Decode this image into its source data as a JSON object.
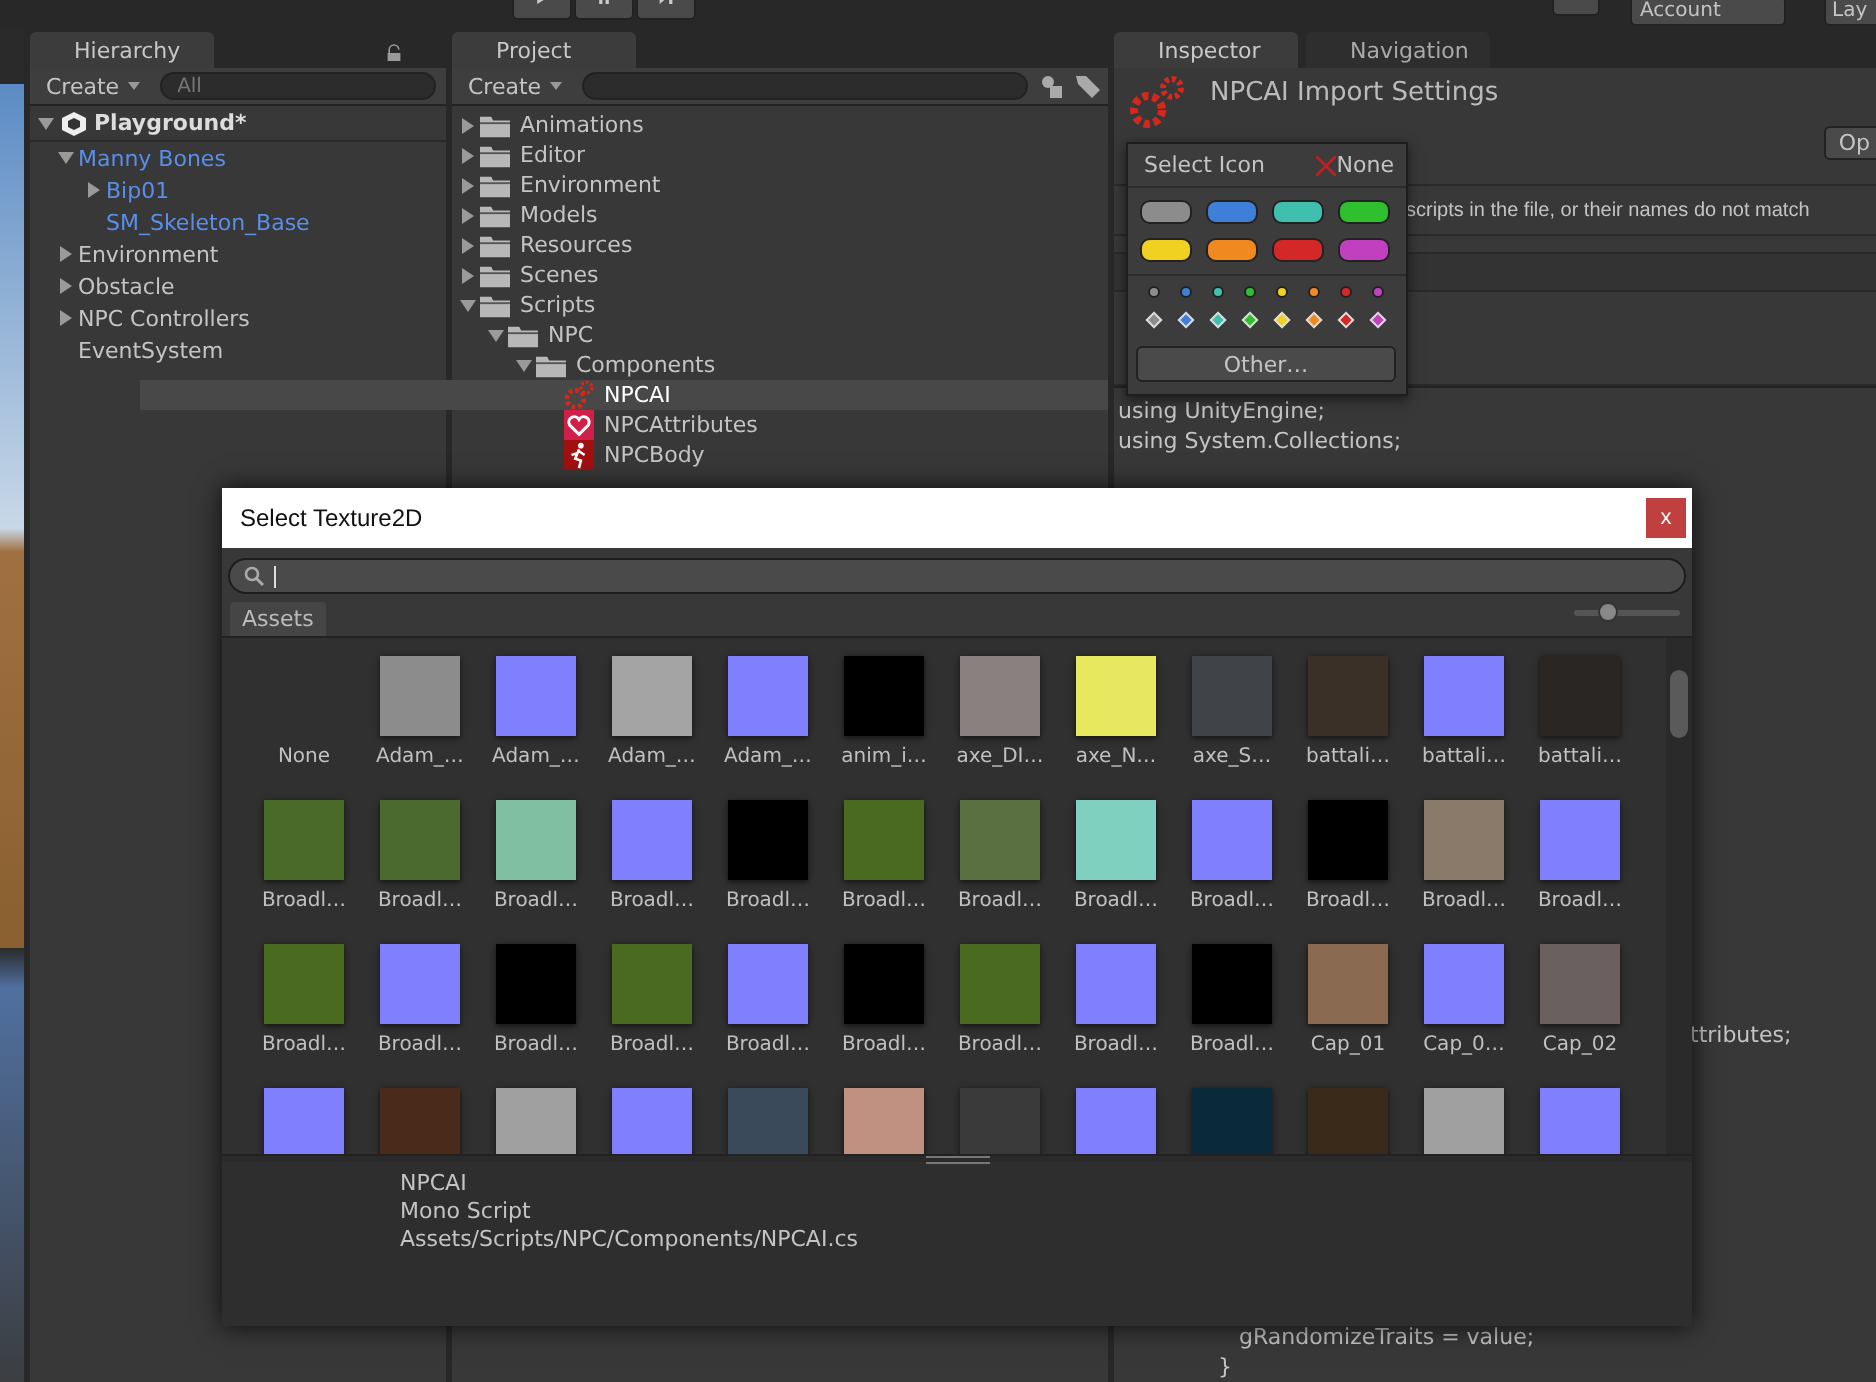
{
  "toolbar": {
    "account": "Account",
    "layout": "Lay"
  },
  "hierarchy": {
    "tab": "Hierarchy",
    "create": "Create",
    "search_placeholder": "All",
    "scene": "Playground*",
    "items": [
      {
        "name": "Manny Bones",
        "prefab": true,
        "expandable": true,
        "expanded": true,
        "children": [
          {
            "name": "Bip01",
            "prefab": true,
            "expandable": true,
            "expanded": false
          },
          {
            "name": "SM_Skeleton_Base",
            "prefab": true,
            "expandable": false
          }
        ]
      },
      {
        "name": "Environment",
        "prefab": false,
        "expandable": true,
        "expanded": false
      },
      {
        "name": "Obstacle",
        "prefab": false,
        "expandable": true,
        "expanded": false
      },
      {
        "name": "NPC Controllers",
        "prefab": false,
        "expandable": true,
        "expanded": false
      },
      {
        "name": "EventSystem",
        "prefab": false,
        "expandable": false
      }
    ]
  },
  "project": {
    "tab": "Project",
    "create": "Create",
    "items": [
      {
        "name": "Animations",
        "kind": "folder",
        "expandable": true,
        "expanded": false,
        "selected": false
      },
      {
        "name": "Editor",
        "kind": "folder",
        "expandable": true,
        "expanded": false,
        "selected": false
      },
      {
        "name": "Environment",
        "kind": "folder",
        "expandable": true,
        "expanded": false,
        "selected": false
      },
      {
        "name": "Models",
        "kind": "folder",
        "expandable": true,
        "expanded": false,
        "selected": false
      },
      {
        "name": "Resources",
        "kind": "folder",
        "expandable": true,
        "expanded": false,
        "selected": false
      },
      {
        "name": "Scenes",
        "kind": "folder",
        "expandable": true,
        "expanded": false,
        "selected": false
      },
      {
        "name": "Scripts",
        "kind": "folder",
        "expandable": true,
        "expanded": true,
        "selected": false,
        "children": [
          {
            "name": "NPC",
            "kind": "folder",
            "expandable": true,
            "expanded": true,
            "selected": false,
            "children": [
              {
                "name": "Components",
                "kind": "folder",
                "expandable": true,
                "expanded": true,
                "selected": false,
                "children": [
                  {
                    "name": "NPCAI",
                    "kind": "script",
                    "expandable": false,
                    "selected": true
                  },
                  {
                    "name": "NPCAttributes",
                    "kind": "heart",
                    "expandable": false,
                    "selected": false
                  },
                  {
                    "name": "NPCBody",
                    "kind": "runner",
                    "expandable": false,
                    "selected": false
                  }
                ]
              }
            ]
          }
        ]
      }
    ]
  },
  "inspector": {
    "tabs": [
      {
        "label": "Inspector",
        "selected": true
      },
      {
        "label": "Navigation",
        "selected": false
      }
    ],
    "title": "NPCAI Import Settings",
    "open_button": "Op",
    "message": "scripts in the file, or their names do not match",
    "code_top": [
      "using UnityEngine;",
      "using System.Collections;"
    ],
    "code_fragment": "ttributes;",
    "code_bottom": [
      "   gRandomizeTraits = value;",
      "}"
    ]
  },
  "icon_picker": {
    "title": "Select Icon",
    "none": "None",
    "other": "Other…",
    "colors": [
      {
        "color": "#8c8c8c"
      },
      {
        "color": "#3f7fd8"
      },
      {
        "color": "#3fbfae"
      },
      {
        "color": "#2fbf2f"
      },
      {
        "color": "#f0d020"
      },
      {
        "color": "#f08a20"
      },
      {
        "color": "#d42828"
      },
      {
        "color": "#c040c0"
      }
    ]
  },
  "dialog": {
    "title": "Select Texture2D",
    "close": "x",
    "tab": "Assets",
    "zoom_slider": {
      "level": 0.33
    },
    "items": [
      {
        "label": "None"
      },
      {
        "label": "Adam_…",
        "color": "#8c8c8c"
      },
      {
        "label": "Adam_…",
        "color": "#8080ff"
      },
      {
        "label": "Adam_…",
        "color": "#a4a4a4"
      },
      {
        "label": "Adam_…",
        "color": "#8080ff"
      },
      {
        "label": "anim_i…",
        "color": "#000000"
      },
      {
        "label": "axe_DI…",
        "color": "#8a8080"
      },
      {
        "label": "axe_N…",
        "color": "#e8e860"
      },
      {
        "label": "axe_S…",
        "color": "#404448"
      },
      {
        "label": "battali…",
        "color": "#3a3028"
      },
      {
        "label": "battali…",
        "color": "#8080ff"
      },
      {
        "label": "battali…",
        "color": "#2a2624"
      },
      {
        "label": "Broadl…",
        "color": "#4a6a2a"
      },
      {
        "label": "Broadl…",
        "color": "#4a6a30"
      },
      {
        "label": "Broadl…",
        "color": "#80c0a0"
      },
      {
        "label": "Broadl…",
        "color": "#8080ff"
      },
      {
        "label": "Broadl…",
        "color": "#000000"
      },
      {
        "label": "Broadl…",
        "color": "#4a6a20"
      },
      {
        "label": "Broadl…",
        "color": "#5a7040"
      },
      {
        "label": "Broadl…",
        "color": "#80d0c0"
      },
      {
        "label": "Broadl…",
        "color": "#8080ff"
      },
      {
        "label": "Broadl…",
        "color": "#000000"
      },
      {
        "label": "Broadl…",
        "color": "#8a7a6a"
      },
      {
        "label": "Broadl…",
        "color": "#8080ff"
      },
      {
        "label": "Broadl…",
        "color": "#4a6a20"
      },
      {
        "label": "Broadl…",
        "color": "#8080ff"
      },
      {
        "label": "Broadl…",
        "color": "#000000"
      },
      {
        "label": "Broadl…",
        "color": "#4a6a20"
      },
      {
        "label": "Broadl…",
        "color": "#8080ff"
      },
      {
        "label": "Broadl…",
        "color": "#000000"
      },
      {
        "label": "Broadl…",
        "color": "#4a6a20"
      },
      {
        "label": "Broadl…",
        "color": "#8080ff"
      },
      {
        "label": "Broadl…",
        "color": "#000000"
      },
      {
        "label": "Cap_01",
        "color": "#8a6a50"
      },
      {
        "label": "Cap_0…",
        "color": "#8080ff"
      },
      {
        "label": "Cap_02",
        "color": "#6a6060"
      },
      {
        "color": "#8080ff"
      },
      {
        "color": "#4a2a1a"
      },
      {
        "color": "#a0a0a0"
      },
      {
        "color": "#8080ff"
      },
      {
        "color": "#3a4a5a"
      },
      {
        "color": "#c09080"
      },
      {
        "color": "#3a3a3a"
      },
      {
        "color": "#8080ff"
      },
      {
        "color": "#0a2a3a"
      },
      {
        "color": "#3a2a1a"
      },
      {
        "color": "#a0a0a0"
      },
      {
        "color": "#8080ff"
      }
    ],
    "info": [
      "NPCAI",
      "Mono Script",
      "Assets/Scripts/NPC/Components/NPCAI.cs"
    ]
  }
}
